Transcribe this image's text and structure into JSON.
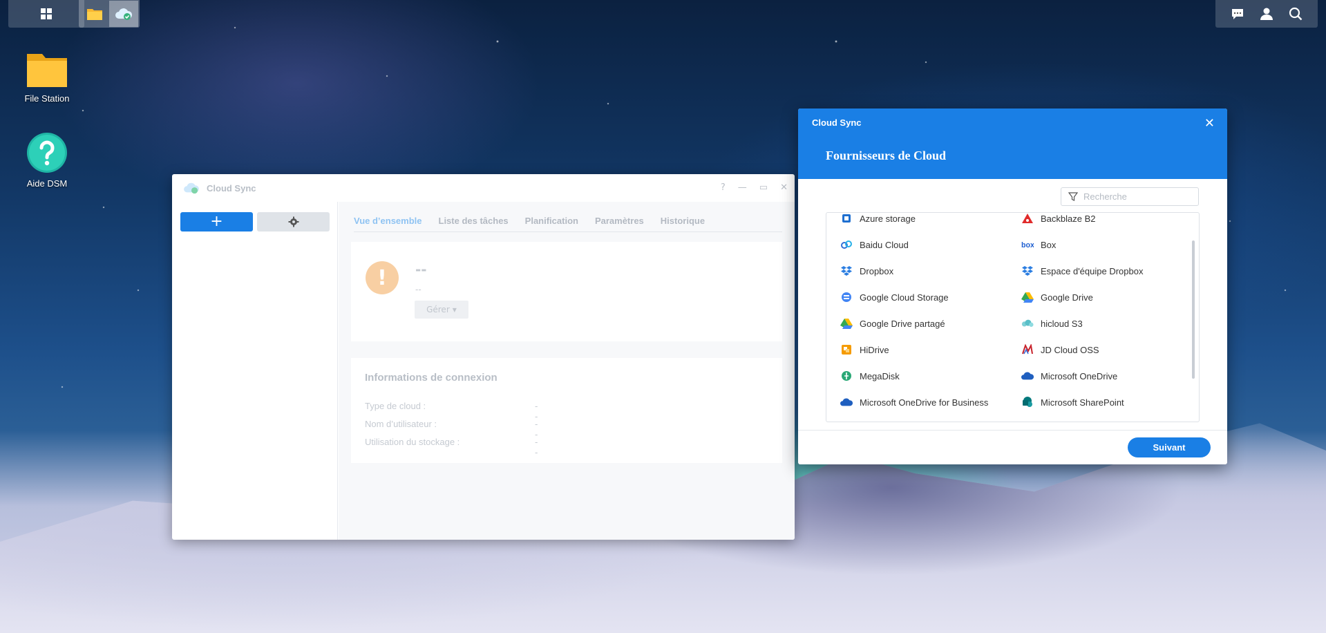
{
  "desktop": {
    "icons": [
      {
        "label": "File Station"
      },
      {
        "label": "Aide DSM"
      }
    ]
  },
  "main_window": {
    "title": "Cloud Sync",
    "tabs": [
      "Vue d’ensemble",
      "Liste des tâches",
      "Planification",
      "Paramètres",
      "Historique"
    ],
    "status_title": "--",
    "status_sub": "--",
    "manage_label": "Gérer",
    "connection": {
      "title": "Informations de connexion",
      "rows": [
        {
          "label": "Type de cloud :",
          "value": "--"
        },
        {
          "label": "Nom d’utilisateur :",
          "value": "--"
        },
        {
          "label": "Utilisation du stockage :",
          "value": "--"
        }
      ]
    }
  },
  "dialog": {
    "app_name": "Cloud Sync",
    "title": "Fournisseurs de Cloud",
    "search_placeholder": "Recherche",
    "next_label": "Suivant",
    "providers": [
      {
        "name": "Azure storage",
        "icon": "azure-icon"
      },
      {
        "name": "Backblaze B2",
        "icon": "backblaze-icon"
      },
      {
        "name": "Baidu Cloud",
        "icon": "baidu-icon"
      },
      {
        "name": "Box",
        "icon": "box-icon"
      },
      {
        "name": "Dropbox",
        "icon": "dropbox-icon"
      },
      {
        "name": "Espace d'équipe Dropbox",
        "icon": "dropbox-icon"
      },
      {
        "name": "Google Cloud Storage",
        "icon": "google-cloud-icon"
      },
      {
        "name": "Google Drive",
        "icon": "google-drive-icon"
      },
      {
        "name": "Google Drive partagé",
        "icon": "google-drive-icon"
      },
      {
        "name": "hicloud S3",
        "icon": "hicloud-icon"
      },
      {
        "name": "HiDrive",
        "icon": "hidrive-icon"
      },
      {
        "name": "JD Cloud OSS",
        "icon": "jd-cloud-icon"
      },
      {
        "name": "MegaDisk",
        "icon": "megadisk-icon"
      },
      {
        "name": "Microsoft OneDrive",
        "icon": "onedrive-icon"
      },
      {
        "name": "Microsoft OneDrive for Business",
        "icon": "onedrive-icon"
      },
      {
        "name": "Microsoft SharePoint",
        "icon": "sharepoint-icon"
      }
    ]
  },
  "colors": {
    "accent": "#1a7fe5"
  }
}
